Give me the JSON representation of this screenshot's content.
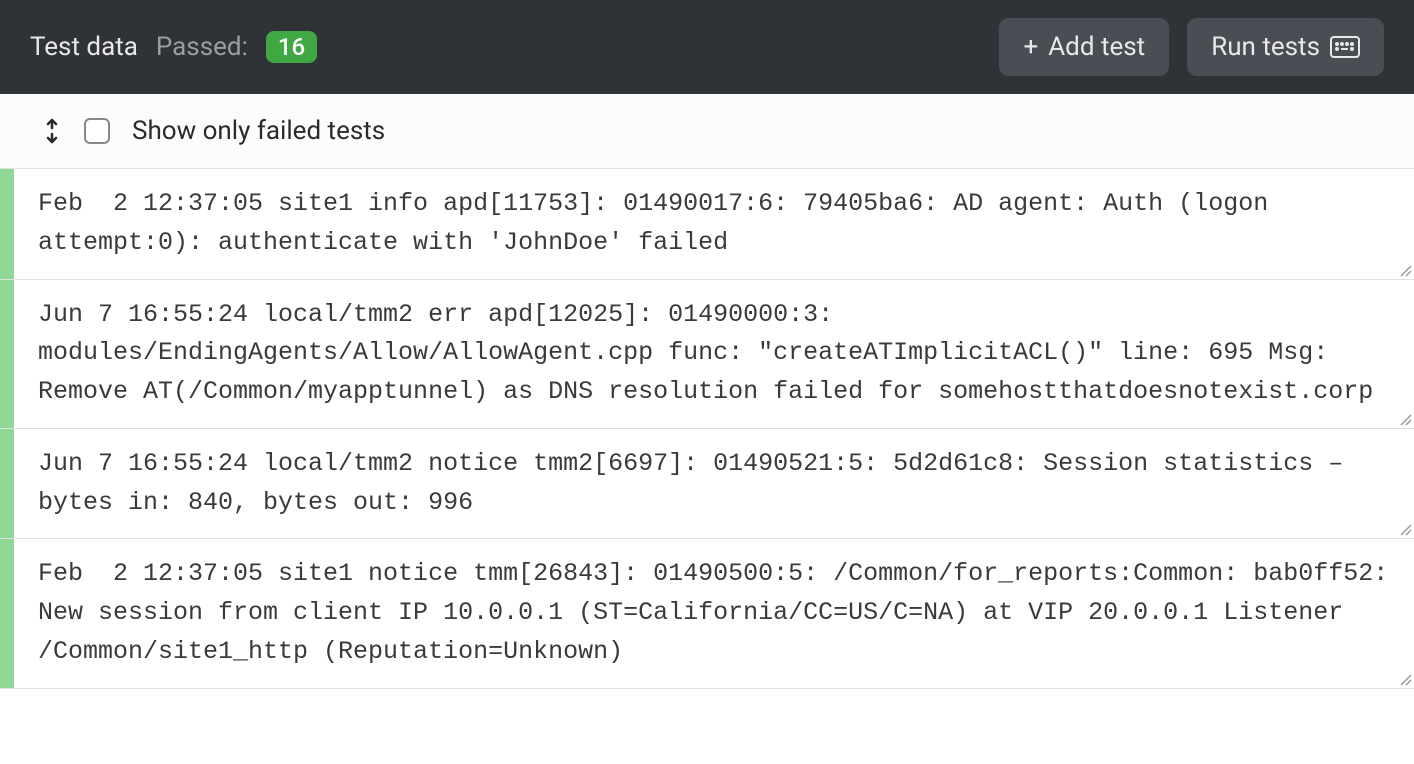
{
  "header": {
    "title": "Test data",
    "passed_label": "Passed:",
    "passed_count": "16",
    "add_test_label": "Add test",
    "run_tests_label": "Run tests"
  },
  "filter": {
    "show_failed_label": "Show only failed tests"
  },
  "tests": [
    {
      "status": "passed",
      "content": "Feb  2 12:37:05 site1 info apd[11753]: 01490017:6: 79405ba6: AD agent: Auth (logon attempt:0): authenticate with 'JohnDoe' failed"
    },
    {
      "status": "passed",
      "content": "Jun 7 16:55:24 local/tmm2 err apd[12025]: 01490000:3: modules/EndingAgents/Allow/AllowAgent.cpp func: \"createATImplicitACL()\" line: 695 Msg: Remove AT(/Common/myapptunnel) as DNS resolution failed for somehostthatdoesnotexist.corp"
    },
    {
      "status": "passed",
      "content": "Jun 7 16:55:24 local/tmm2 notice tmm2[6697]: 01490521:5: 5d2d61c8: Session statistics – bytes in: 840, bytes out: 996"
    },
    {
      "status": "passed",
      "content": "Feb  2 12:37:05 site1 notice tmm[26843]: 01490500:5: /Common/for_reports:Common: bab0ff52: New session from client IP 10.0.0.1 (ST=California/CC=US/C=NA) at VIP 20.0.0.1 Listener /Common/site1_http (Reputation=Unknown)"
    }
  ]
}
